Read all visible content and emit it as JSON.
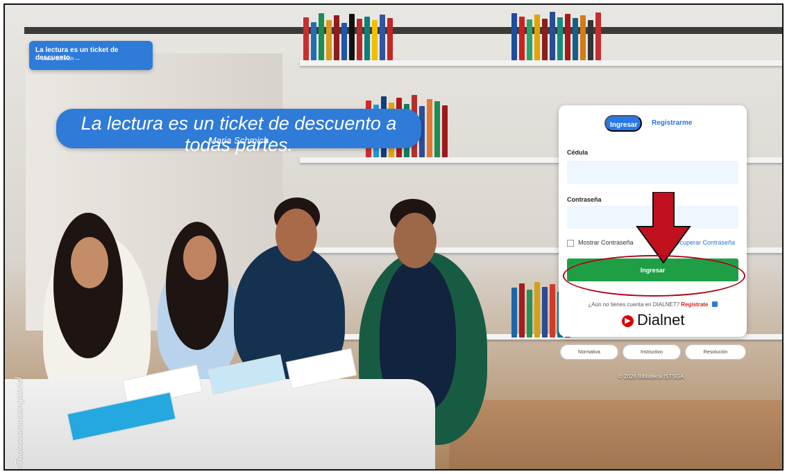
{
  "left_quote": {
    "title": "La lectura es un ticket de descuento",
    "author": "— Maria Schmich —"
  },
  "main_quote": {
    "text": "La lectura es un ticket de descuento a todas partes.",
    "author": "- Maria Schmich -"
  },
  "login": {
    "tabs": {
      "active": "Ingresar",
      "secondary": "Registrarme"
    },
    "fields": {
      "id_label": "Cédula",
      "password_label": "Contraseña"
    },
    "show_password": "Mostrar Contraseña",
    "recover": "Recuperar Contraseña",
    "submit": "Ingresar",
    "note": "¿Aún no tienes cuenta en DIALNET? ",
    "register_link": "Regístrate",
    "brand": "Dialnet"
  },
  "footer_buttons": [
    "Normativa",
    "Instructivo",
    "Resolución"
  ],
  "copyright": "© 2026 Biblioteca ISTSGA",
  "vertical_tag": "#Todossomosangabriel",
  "colors": {
    "primary_blue": "#2f7bd8",
    "submit_green": "#1f9f45",
    "arrow_red": "#c1111f"
  }
}
